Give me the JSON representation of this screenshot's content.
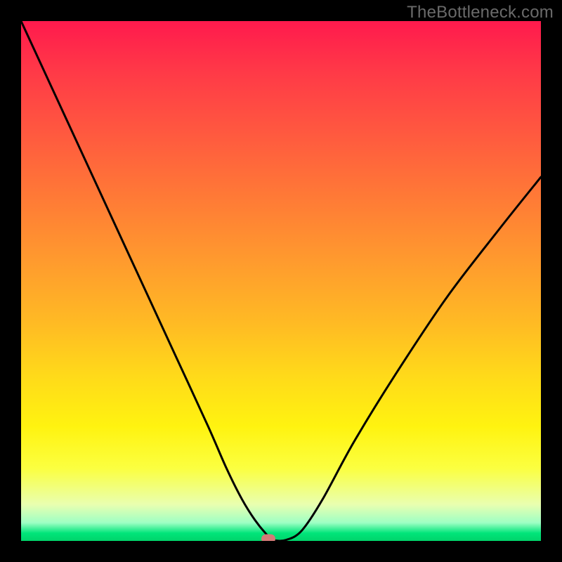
{
  "watermark": "TheBottleneck.com",
  "chart_data": {
    "type": "line",
    "title": "",
    "xlabel": "",
    "ylabel": "",
    "xlim": [
      0,
      1
    ],
    "ylim": [
      0,
      1
    ],
    "grid": false,
    "legend": false,
    "marker": {
      "x_frac": 0.475,
      "y_frac": 0.996
    },
    "series": [
      {
        "name": "bottleneck-curve",
        "color": "#000000",
        "x": [
          0.0,
          0.06,
          0.12,
          0.18,
          0.24,
          0.3,
          0.36,
          0.395,
          0.425,
          0.45,
          0.47,
          0.485,
          0.51,
          0.54,
          0.58,
          0.64,
          0.72,
          0.82,
          0.92,
          1.0
        ],
        "y": [
          1.0,
          0.87,
          0.74,
          0.61,
          0.48,
          0.35,
          0.22,
          0.14,
          0.08,
          0.04,
          0.015,
          0.002,
          0.002,
          0.02,
          0.08,
          0.19,
          0.32,
          0.47,
          0.6,
          0.7
        ]
      }
    ]
  }
}
